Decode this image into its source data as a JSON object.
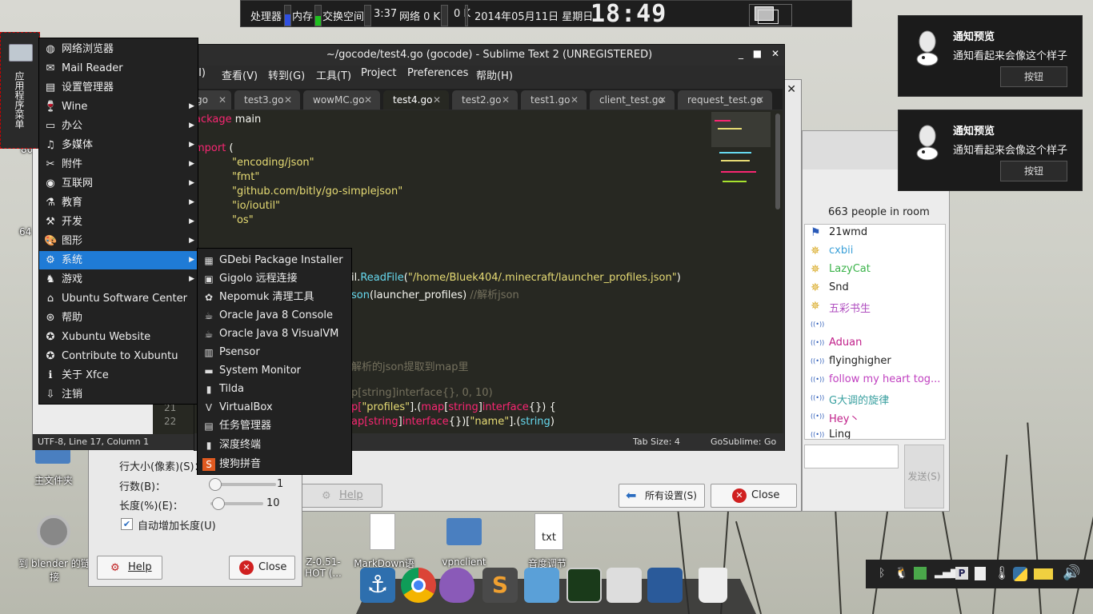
{
  "top_panel": {
    "cpu_label": "处理器",
    "mem_label": "内存",
    "swap_label": "交换空间",
    "uptime": "3:37",
    "net_label": "网络 0 K",
    "net_down": "0 K",
    "date": "2014年05月11日 星期日",
    "clock": "18:49"
  },
  "notifications": [
    {
      "title": "通知预览",
      "body": "通知看起来会像这个样子",
      "button": "按钮"
    },
    {
      "title": "通知预览",
      "body": "通知看起来会像这个样子",
      "button": "按钮"
    }
  ],
  "launcher": {
    "label": "应用程序菜单"
  },
  "app_menu": {
    "items": [
      {
        "label": "网络浏览器",
        "icon": "globe-icon",
        "submenu": false
      },
      {
        "label": "Mail Reader",
        "icon": "mail-icon",
        "submenu": false
      },
      {
        "label": "设置管理器",
        "icon": "settings-icon",
        "submenu": false
      },
      {
        "label": "Wine",
        "icon": "wine-icon",
        "submenu": true
      },
      {
        "label": "办公",
        "icon": "office-icon",
        "submenu": true
      },
      {
        "label": "多媒体",
        "icon": "multimedia-icon",
        "submenu": true
      },
      {
        "label": "附件",
        "icon": "accessories-icon",
        "submenu": true
      },
      {
        "label": "互联网",
        "icon": "internet-icon",
        "submenu": true
      },
      {
        "label": "教育",
        "icon": "education-icon",
        "submenu": true
      },
      {
        "label": "开发",
        "icon": "development-icon",
        "submenu": true
      },
      {
        "label": "图形",
        "icon": "graphics-icon",
        "submenu": true
      },
      {
        "label": "系统",
        "icon": "system-icon",
        "submenu": true,
        "selected": true
      },
      {
        "label": "游戏",
        "icon": "games-icon",
        "submenu": true
      },
      {
        "label": "Ubuntu Software Center",
        "icon": "software-center-icon",
        "submenu": false
      },
      {
        "label": "帮助",
        "icon": "help-icon",
        "submenu": false
      },
      {
        "label": "Xubuntu Website",
        "icon": "xubuntu-icon",
        "submenu": false
      },
      {
        "label": "Contribute to Xubuntu",
        "icon": "xubuntu-icon",
        "submenu": false
      },
      {
        "label": "关于 Xfce",
        "icon": "info-icon",
        "submenu": false
      },
      {
        "label": "注销",
        "icon": "logout-icon",
        "submenu": false
      }
    ]
  },
  "system_submenu": {
    "items": [
      {
        "label": "GDebi Package Installer",
        "icon": "package-icon"
      },
      {
        "label": "Gigolo 远程连接",
        "icon": "remote-icon"
      },
      {
        "label": "Nepomuk 清理工具",
        "icon": "nepomuk-icon"
      },
      {
        "label": "Oracle Java 8 Console",
        "icon": "java-icon"
      },
      {
        "label": "Oracle Java 8 VisualVM",
        "icon": "java-icon"
      },
      {
        "label": "Psensor",
        "icon": "psensor-icon"
      },
      {
        "label": "System Monitor",
        "icon": "monitor-icon"
      },
      {
        "label": "Tilda",
        "icon": "terminal-icon"
      },
      {
        "label": "VirtualBox",
        "icon": "virtualbox-icon"
      },
      {
        "label": "任务管理器",
        "icon": "task-manager-icon"
      },
      {
        "label": "深度终端",
        "icon": "terminal-icon"
      },
      {
        "label": "搜狗拼音",
        "icon": "sogou-icon"
      }
    ]
  },
  "sublime": {
    "title": "~/gocode/test4.go (gocode) - Sublime Text 2 (UNREGISTERED)",
    "menu": [
      "(I)",
      "查看(V)",
      "转到(G)",
      "工具(T)",
      "Project",
      "Preferences",
      "帮助(H)"
    ],
    "tabs": [
      "go",
      "test3.go",
      "wowMC.go",
      "test4.go",
      "test2.go",
      "test1.go",
      "client_test.go",
      "request_test.go"
    ],
    "active_tab": "test4.go",
    "status_left": "UTF-8, Line 17, Column 1",
    "status_tab": "Tab Size: 4",
    "status_syntax": "GoSublime: Go",
    "code": {
      "package_kw": "ackage",
      "package_name": "main",
      "import_kw": "mport",
      "import_paren": "(",
      "imports": [
        "\"encoding/json\"",
        "\"fmt\"",
        "\"github.com/bitly/go-simplejson\"",
        "\"io/ioutil\"",
        "\"os\""
      ],
      "readfile_prefix": "il.",
      "readfile_fn": "ReadFile",
      "readfile_arg": "\"/home/Bluek404/.minecraft/launcher_profiles.json\"",
      "readfile_close": ")",
      "json_fn": "son",
      "json_arg": "(launcher_profiles)",
      "json_comment": "//解析json",
      "comment2": "解析的json提取到map里",
      "make_line": "p[string]interface{}, 0, 10)",
      "l21_a": "p[",
      "l21_b": "\"profiles\"",
      "l21_c": "].(",
      "l21_d": "map",
      "l21_e": "[",
      "l21_f": "string",
      "l21_g": "]",
      "l21_h": "interface",
      "l21_i": "{}) {",
      "l22_a": "ap[",
      "l22_b": "string",
      "l22_c": "]",
      "l22_d": "interface",
      "l22_e": "{})[",
      "l22_f": "\"name\"",
      "l22_g": "].(",
      "l22_h": "string",
      "l22_i": ")",
      "line_numbers": [
        "21",
        "22"
      ]
    }
  },
  "settings_dialog": {
    "help": "Help",
    "all_settings": "所有设置(S)",
    "close": "Close"
  },
  "chat": {
    "people": "663 people in room",
    "send": "发送(S)",
    "percent": "%",
    "users": [
      {
        "name": "21wmd",
        "color": "#222222",
        "icon": "flag-icon"
      },
      {
        "name": "cxbii",
        "color": "#3aa0d8",
        "icon": "star-icon"
      },
      {
        "name": "LazyCat",
        "color": "#3bb34a",
        "icon": "star-icon"
      },
      {
        "name": "Snd",
        "color": "#222222",
        "icon": "star-icon"
      },
      {
        "name": "五彩书生",
        "color": "#b04fc0",
        "icon": "star-icon"
      },
      {
        "name": "",
        "color": "#222222",
        "icon": "voice-icon"
      },
      {
        "name": "Aduan",
        "color": "#c0208a",
        "icon": "voice-icon"
      },
      {
        "name": "flyinghigher",
        "color": "#222222",
        "icon": "voice-icon"
      },
      {
        "name": "follow my heart tog...",
        "color": "#c040c0",
        "icon": "voice-icon"
      },
      {
        "name": "G大调的旋律",
        "color": "#3aa0a0",
        "icon": "voice-icon"
      },
      {
        "name": "Hey丶",
        "color": "#c0208a",
        "icon": "voice-icon"
      },
      {
        "name": "Ling",
        "color": "#222222",
        "icon": "voice-icon"
      }
    ]
  },
  "left_dialog": {
    "row1_label": "行大小(像素)(S)：",
    "row2_label": "行数(B)：",
    "row2_value": "1",
    "row3_label": "长度(%)(E)：",
    "row3_value": "10",
    "checkbox_label": "自动增加长度(U)",
    "help": "Help",
    "close": "Close"
  },
  "sublime_statusbar_left": "UTF-8, Line 17, Column 1",
  "desktop": {
    "home_label": "主文件夹",
    "blender_label": "到 blender 的链接",
    "label_64": "64",
    "label_80": "80",
    "file1_label": "Z-0.51-\nHOT (...",
    "markdown_label": "MarkDown语\n量",
    "vpn_label": "vpnclient",
    "volume_label": "音度调节",
    "txt_label": "txt"
  },
  "colors": {
    "menu_selected": "#1f7bd6",
    "accent": "#f92672"
  }
}
